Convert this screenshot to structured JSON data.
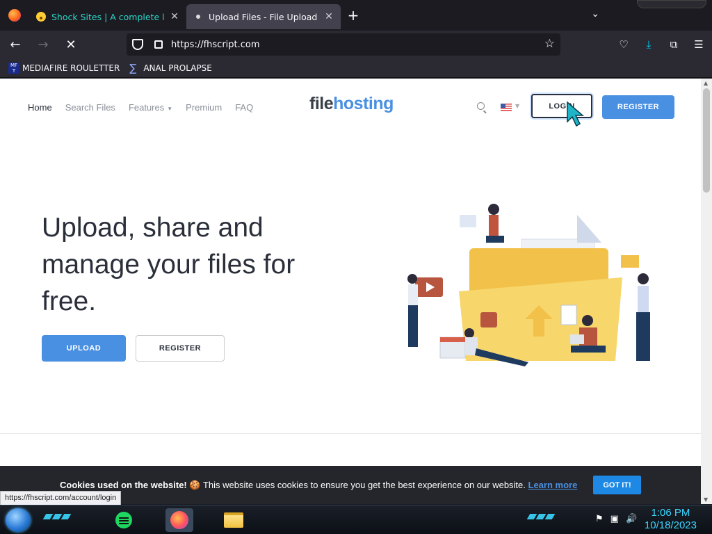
{
  "browser": {
    "tabs": [
      {
        "title": "Shock Sites | A complete list of",
        "active": false
      },
      {
        "title": "Upload Files - File Upload Script",
        "active": true
      }
    ],
    "url": "https://fhscript.com",
    "bookmarks": [
      {
        "label": "MEDIAFIRE ROULETTER",
        "icon_text": "MF T"
      },
      {
        "label": "ANAL PROLAPSE",
        "icon": "sigma-icon"
      }
    ],
    "status_url": "https://fhscript.com/account/login"
  },
  "site": {
    "logo_part1": "file",
    "logo_part2": "hosting",
    "nav": [
      {
        "label": "Home",
        "active": true
      },
      {
        "label": "Search Files"
      },
      {
        "label": "Features",
        "dropdown": true
      },
      {
        "label": "Premium"
      },
      {
        "label": "FAQ"
      }
    ],
    "login_label": "LOGIN",
    "register_label": "REGISTER",
    "hero_title": "Upload, share and manage your files for free.",
    "upload_label": "UPLOAD",
    "register2_label": "REGISTER",
    "accent_color": "#4a90e2"
  },
  "cookie": {
    "bold": "Cookies used on the website!",
    "emoji": "🍪",
    "text": " This website uses cookies to ensure you get the best experience on our website. ",
    "learn_more": "Learn more",
    "button": "GOT IT!"
  },
  "taskbar": {
    "time": "1:06 PM",
    "date": "10/18/2023"
  }
}
